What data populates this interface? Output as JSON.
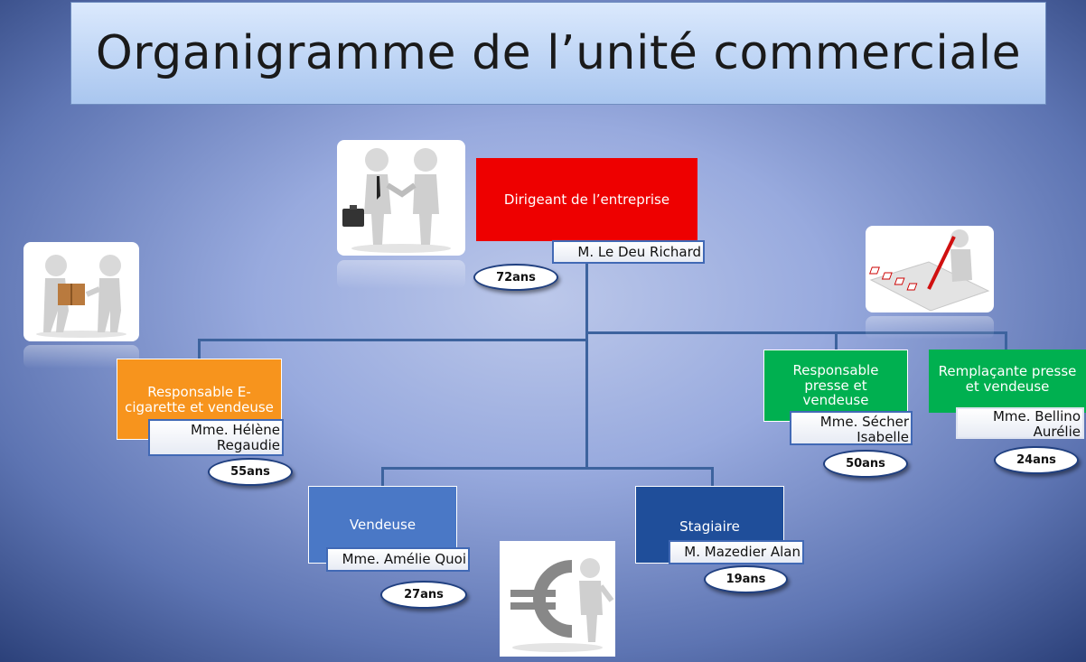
{
  "title": "Organigramme de l’unité commerciale",
  "nodes": {
    "dirigeant": {
      "role": "Dirigeant de l’entreprise",
      "name": "M. Le Deu Richard",
      "age": "72ans",
      "color": "#ee0000"
    },
    "ecig": {
      "role": "Responsable E-cigarette et vendeuse",
      "name": "Mme. Hélène Regaudie",
      "age": "55ans",
      "color": "#f7941d"
    },
    "presse": {
      "role": "Responsable presse et vendeuse",
      "name": "Mme. Sécher Isabelle",
      "age": "50ans",
      "color": "#00b050"
    },
    "remplacante": {
      "role": "Remplaçante presse et vendeuse",
      "name": "Mme. Bellino Aurélie",
      "age": "24ans",
      "color": "#00b050"
    },
    "vendeuse": {
      "role": "Vendeuse",
      "name": "Mme. Amélie Quoi",
      "age": "27ans",
      "color": "#4a78c6"
    },
    "stagiaire": {
      "role": "Stagiaire",
      "name": "M. Mazedier Alan",
      "age": "19ans",
      "color": "#1f4e9a"
    }
  },
  "images": {
    "handshake": "handshake-icon",
    "delivery": "package-delivery-icon",
    "checklist": "checklist-icon",
    "euro": "euro-icon"
  }
}
